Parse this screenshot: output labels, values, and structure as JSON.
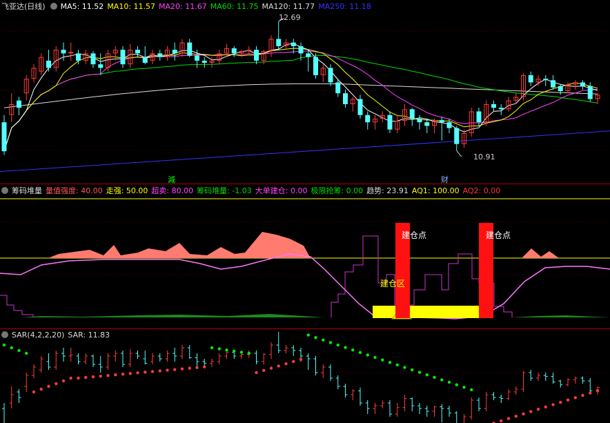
{
  "main_header": {
    "title": "飞亚达(日线)",
    "ma5": "MA5: 11.52",
    "ma10": "MA10: 11.57",
    "ma20": "MA20: 11.67",
    "ma60": "MA60: 11.75",
    "ma120": "MA120: 11.77",
    "ma250": "MA250: 11.18"
  },
  "main_annotations": {
    "high_label": "12.69",
    "low_label": "10.91",
    "marker_reduce": "減",
    "marker_finance": "财"
  },
  "ind_header": {
    "name": "筹码堆量",
    "p1": "量值强度: 40.00",
    "p2": "走强: 50.00",
    "p3": "超卖: 80.00",
    "p4": "筹码堆量: -1.03",
    "p5": "大单建仓: 0.00",
    "p6": "极限抢筹: 0.00",
    "p7": "趋势: 23.91",
    "p8": "AQ1: 100.00",
    "p9": "AQ2: 0.00"
  },
  "ind_annotations": {
    "build_point_1": "建仓点",
    "build_point_2": "建仓点",
    "build_zone": "建仓区"
  },
  "sar_header": {
    "name": "SAR(4,2,2,20)",
    "value": "SAR: 11.83"
  },
  "colors": {
    "up": "#ff3c3c",
    "down": "#54ffff",
    "ma5": "#ffffff",
    "ma10": "#ffff00",
    "ma20": "#ff44ff",
    "ma60": "#00dd00",
    "ma120": "#dddddd",
    "ma250": "#3333ff"
  },
  "chart_data": {
    "type": "candlestick",
    "candles": [
      [
        11.3,
        10.9,
        10.85,
        11.4
      ],
      [
        11.4,
        11.55,
        11.3,
        11.7
      ],
      [
        11.6,
        11.5,
        11.4,
        11.65
      ],
      [
        11.7,
        11.9,
        11.6,
        11.95
      ],
      [
        11.9,
        12.05,
        11.85,
        12.1
      ],
      [
        12.0,
        12.2,
        11.95,
        12.25
      ],
      [
        12.15,
        12.05,
        12.0,
        12.3
      ],
      [
        12.05,
        12.3,
        12.0,
        12.35
      ],
      [
        12.3,
        12.25,
        12.15,
        12.4
      ],
      [
        12.25,
        12.27,
        12.15,
        12.4
      ],
      [
        12.25,
        12.15,
        12.1,
        12.3
      ],
      [
        12.15,
        12.25,
        12.1,
        12.3
      ],
      [
        12.25,
        12.1,
        12.05,
        12.28
      ],
      [
        12.1,
        12.05,
        11.95,
        12.25
      ],
      [
        12.05,
        12.25,
        12.0,
        12.3
      ],
      [
        12.25,
        12.3,
        12.15,
        12.35
      ],
      [
        12.3,
        12.1,
        12.05,
        12.35
      ],
      [
        12.1,
        12.3,
        12.05,
        12.38
      ],
      [
        12.3,
        12.25,
        12.2,
        12.35
      ],
      [
        12.2,
        12.12,
        12.1,
        12.35
      ],
      [
        12.15,
        12.25,
        12.1,
        12.3
      ],
      [
        12.25,
        12.2,
        12.15,
        12.3
      ],
      [
        12.2,
        12.3,
        12.15,
        12.35
      ],
      [
        12.3,
        12.25,
        12.15,
        12.4
      ],
      [
        12.25,
        12.4,
        12.2,
        12.45
      ],
      [
        12.4,
        12.22,
        12.2,
        12.45
      ],
      [
        12.22,
        12.15,
        12.05,
        12.3
      ],
      [
        12.15,
        12.12,
        12.05,
        12.2
      ],
      [
        12.12,
        12.15,
        12.05,
        12.2
      ],
      [
        12.15,
        12.25,
        12.1,
        12.3
      ],
      [
        12.25,
        12.32,
        12.2,
        12.38
      ],
      [
        12.32,
        12.25,
        12.2,
        12.35
      ],
      [
        12.25,
        12.28,
        12.2,
        12.3
      ],
      [
        12.28,
        12.3,
        12.22,
        12.35
      ],
      [
        12.3,
        12.15,
        12.1,
        12.35
      ],
      [
        12.15,
        12.28,
        12.1,
        12.3
      ],
      [
        12.28,
        12.45,
        12.2,
        12.5
      ],
      [
        12.45,
        12.35,
        12.3,
        12.69
      ],
      [
        12.35,
        12.4,
        12.3,
        12.45
      ],
      [
        12.4,
        12.35,
        12.25,
        12.45
      ],
      [
        12.35,
        12.25,
        12.15,
        12.4
      ],
      [
        12.25,
        12.2,
        12.0,
        12.3
      ],
      [
        12.2,
        11.95,
        11.9,
        12.25
      ],
      [
        11.95,
        12.05,
        11.85,
        12.1
      ],
      [
        12.05,
        11.85,
        11.8,
        12.1
      ],
      [
        11.85,
        11.7,
        11.65,
        11.9
      ],
      [
        11.7,
        11.55,
        11.5,
        11.75
      ],
      [
        11.55,
        11.62,
        11.45,
        11.65
      ],
      [
        11.62,
        11.4,
        11.35,
        11.68
      ],
      [
        11.4,
        11.3,
        11.2,
        11.45
      ],
      [
        11.3,
        11.35,
        11.2,
        11.4
      ],
      [
        11.35,
        11.4,
        11.3,
        11.45
      ],
      [
        11.4,
        11.2,
        11.15,
        11.45
      ],
      [
        11.2,
        11.32,
        11.15,
        11.4
      ],
      [
        11.32,
        11.48,
        11.25,
        11.55
      ],
      [
        11.48,
        11.35,
        11.25,
        11.5
      ],
      [
        11.35,
        11.3,
        11.2,
        11.4
      ],
      [
        11.3,
        11.25,
        11.15,
        11.35
      ],
      [
        11.25,
        11.33,
        11.15,
        11.35
      ],
      [
        11.33,
        11.3,
        11.05,
        11.38
      ],
      [
        11.3,
        11.22,
        11.15,
        11.35
      ],
      [
        11.22,
        11.0,
        10.91,
        11.25
      ],
      [
        11.0,
        11.15,
        10.95,
        11.2
      ],
      [
        11.15,
        11.45,
        11.1,
        11.5
      ],
      [
        11.45,
        11.3,
        11.25,
        11.5
      ],
      [
        11.3,
        11.55,
        11.25,
        11.6
      ],
      [
        11.55,
        11.5,
        11.45,
        11.6
      ],
      [
        11.5,
        11.48,
        11.4,
        11.55
      ],
      [
        11.48,
        11.6,
        11.45,
        11.65
      ],
      [
        11.6,
        11.65,
        11.55,
        11.7
      ],
      [
        11.65,
        11.95,
        11.6,
        11.98
      ],
      [
        11.95,
        11.85,
        11.8,
        12.0
      ],
      [
        11.85,
        11.9,
        11.8,
        11.95
      ],
      [
        11.9,
        11.88,
        11.8,
        11.95
      ],
      [
        11.88,
        11.78,
        11.75,
        11.95
      ],
      [
        11.8,
        11.73,
        11.68,
        11.82
      ],
      [
        11.73,
        11.82,
        11.7,
        11.85
      ],
      [
        11.82,
        11.85,
        11.75,
        11.88
      ],
      [
        11.85,
        11.8,
        11.75,
        11.88
      ],
      [
        11.8,
        11.62,
        11.58,
        11.85
      ],
      [
        11.62,
        11.68,
        11.55,
        11.7
      ]
    ],
    "high": 12.69,
    "low": 10.91,
    "ma250": {
      "from": 10.62,
      "to": 11.18
    },
    "indicator": {
      "strength": 40.0,
      "go_strong": 50.0,
      "oversold": 80.0,
      "chip_volume": -1.03,
      "large_order_build": 0.0,
      "extreme_grab": 0.0,
      "trend": 23.91,
      "aq1": 100.0,
      "aq2": 0.0
    },
    "sar": {
      "params": [
        4,
        2,
        2,
        20
      ],
      "value": 11.83
    }
  }
}
